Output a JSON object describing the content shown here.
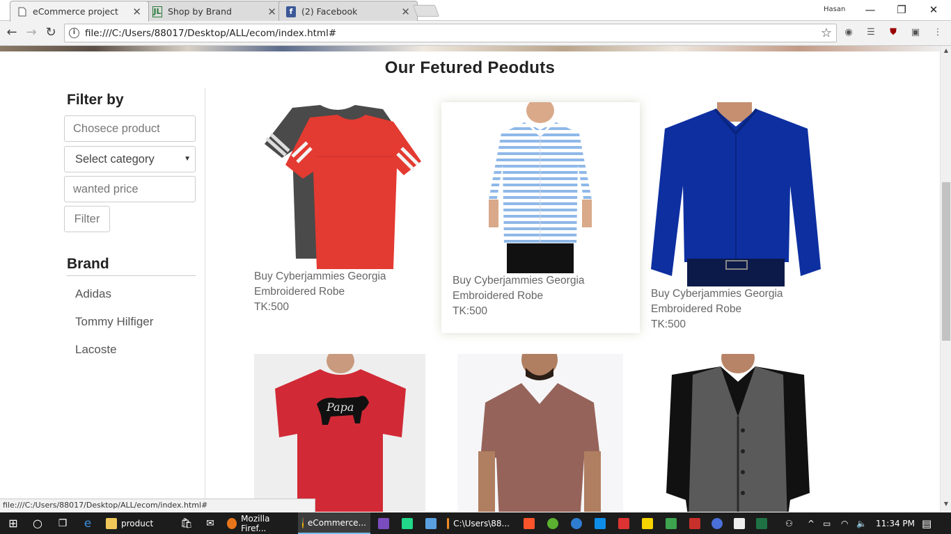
{
  "browser": {
    "tabs": [
      {
        "title": "eCommerce project",
        "favicon": "page-icon",
        "active": true
      },
      {
        "title": "Shop by Brand",
        "favicon": "JL",
        "active": false
      },
      {
        "title": "(2) Facebook",
        "favicon": "f",
        "active": false
      }
    ],
    "user": "Hasan",
    "url": "file:///C:/Users/88017/Desktop/ALL/ecom/index.html#",
    "status_url": "file:///C:/Users/88017/Desktop/ALL/ecom/index.html#"
  },
  "page": {
    "heading": "Our Fetured Peoduts",
    "filter": {
      "title": "Filter by",
      "product_placeholder": "Chosece product",
      "category_value": "Select category",
      "price_placeholder": "wanted price",
      "button": "Filter"
    },
    "brand": {
      "title": "Brand",
      "items": [
        "Adidas",
        "Tommy Hilfiger",
        "Lacoste"
      ]
    },
    "products": [
      {
        "name": "Buy Cyberjammies Georgia Embroidered Robe",
        "price": "TK:500",
        "image": "red-and-grey-tshirts"
      },
      {
        "name": "Buy Cyberjammies Georgia Embroidered Robe",
        "price": "TK:500",
        "image": "blue-striped-shirt"
      },
      {
        "name": "Buy Cyberjammies Georgia Embroidered Robe",
        "price": "TK:500",
        "image": "royal-blue-shirt"
      },
      {
        "image": "red-papa-bear-tshirt",
        "shirt_text": "Papa"
      },
      {
        "image": "brown-vneck-tshirt"
      },
      {
        "image": "grey-waistcoat"
      }
    ]
  },
  "taskbar": {
    "apps": [
      {
        "label": "product",
        "icon": "folder-icon"
      },
      {
        "label": "Mozilla Firef...",
        "icon": "firefox-icon"
      },
      {
        "label": "eCommerce...",
        "icon": "chrome-icon"
      },
      {
        "label": "C:\\Users\\88...",
        "icon": "sublime-icon"
      }
    ],
    "clock": "11:34 PM"
  },
  "colors": {
    "accent": "#76b9ed",
    "price_text": "#666666",
    "heading": "#222222"
  }
}
